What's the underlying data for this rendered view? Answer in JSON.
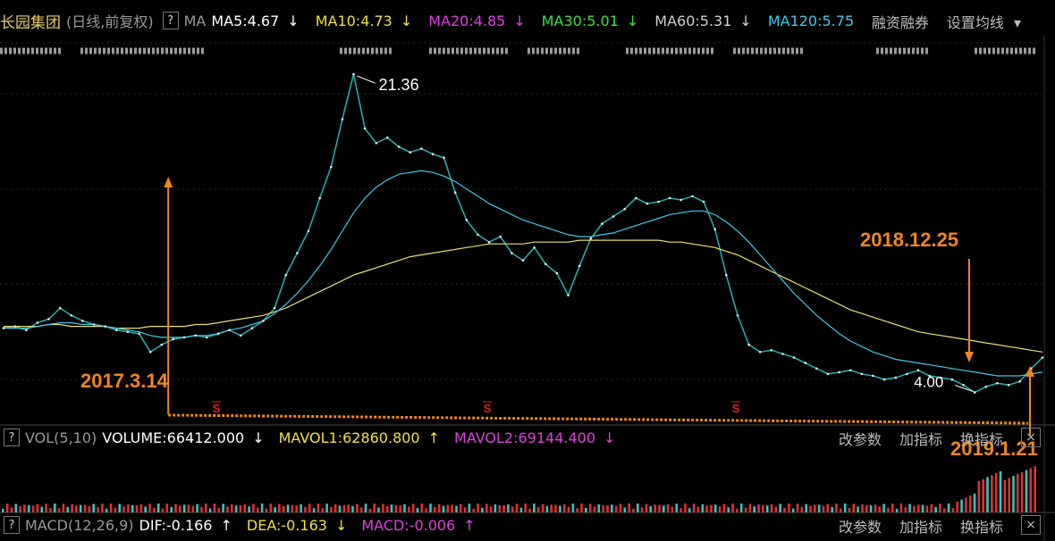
{
  "header": {
    "stock_name": "长园集团",
    "mode": "(日线,前复权)",
    "help": "?",
    "ma_label": "MA",
    "ma_items": [
      {
        "label": "MA5:4.67",
        "arrow": "↓",
        "color": "#ffffff"
      },
      {
        "label": "MA10:4.73",
        "arrow": "↓",
        "color": "#f0e040"
      },
      {
        "label": "MA20:4.85",
        "arrow": "↓",
        "color": "#e040e0"
      },
      {
        "label": "MA30:5.01",
        "arrow": "↓",
        "color": "#40e040"
      },
      {
        "label": "MA60:5.31",
        "arrow": "↓",
        "color": "#d0d0d0"
      },
      {
        "label": "MA120:5.75",
        "arrow": "",
        "color": "#40c8e8"
      }
    ],
    "margin_label": "融资融券",
    "settings_label": "设置均线",
    "settings_arrow": "▾"
  },
  "volume_panel": {
    "help": "?",
    "name": "VOL(5,10)",
    "items": [
      {
        "label": "VOLUME:66412.000",
        "arrow": "↓",
        "color": "#ffffff"
      },
      {
        "label": "MAVOL1:62860.800",
        "arrow": "↑",
        "color": "#f0e040"
      },
      {
        "label": "MAVOL2:69144.400",
        "arrow": "↓",
        "color": "#e040e0"
      }
    ],
    "buttons": [
      "改参数",
      "加指标",
      "换指标"
    ],
    "close": "×"
  },
  "macd_panel": {
    "help": "?",
    "name": "MACD(12,26,9)",
    "items": [
      {
        "label": "DIF:-0.166",
        "arrow": "↑",
        "color": "#ffffff"
      },
      {
        "label": "DEA:-0.163",
        "arrow": "↓",
        "color": "#f0e040"
      },
      {
        "label": "MACD:-0.006",
        "arrow": "↑",
        "color": "#e040e0"
      }
    ],
    "buttons": [
      "改参数",
      "加指标",
      "换指标"
    ],
    "close": "×"
  },
  "annotations": {
    "high_price": "21.36",
    "low_price": "4.00",
    "date_2017": "2017.3.14",
    "date_2018": "2018.12.25",
    "date_2019": "2019.1.21",
    "signal_marker": "S"
  },
  "colors": {
    "annotation_orange": "#f0861e",
    "price_line": "#2aa8a8",
    "ma_yellow": "#e8e070",
    "ma_cyan": "#40c8e8",
    "volume_red": "#e03030",
    "volume_cyan": "#40c0c0",
    "signal_red": "#e02020"
  },
  "chart_data": {
    "type": "line",
    "ylim": [
      3,
      22
    ],
    "series": [
      {
        "values": [
          7.5,
          7.6,
          7.4,
          7.8,
          8.0,
          8.6,
          8.2,
          7.9,
          7.7,
          7.6,
          7.4,
          7.3,
          7.2,
          6.2,
          6.6,
          6.9,
          7.0,
          7.1,
          7.0,
          7.2,
          7.4,
          7.1,
          7.5,
          7.9,
          8.6,
          10.4,
          11.6,
          12.8,
          14.6,
          16.3,
          18.9,
          21.36,
          18.4,
          17.6,
          17.9,
          17.4,
          17.1,
          17.3,
          17.0,
          16.8,
          14.9,
          13.4,
          12.6,
          12.2,
          12.5,
          11.6,
          11.2,
          11.9,
          11.0,
          10.5,
          9.3,
          10.9,
          12.4,
          13.2,
          13.6,
          14.0,
          14.6,
          14.3,
          14.4,
          14.6,
          14.5,
          14.7,
          14.4,
          12.9,
          10.4,
          8.2,
          6.6,
          6.2,
          6.3,
          6.1,
          5.9,
          5.6,
          5.3,
          5.0,
          5.1,
          5.2,
          5.0,
          4.9,
          4.7,
          4.8,
          5.0,
          5.2,
          4.9,
          4.8,
          4.7,
          4.4,
          4.0,
          4.3,
          4.5,
          4.4,
          4.6,
          5.3,
          5.9
        ]
      },
      {
        "values": [
          7.6,
          7.6,
          7.6,
          7.6,
          7.7,
          7.7,
          7.6,
          7.6,
          7.6,
          7.6,
          7.5,
          7.5,
          7.5,
          7.6,
          7.6,
          7.6,
          7.6,
          7.7,
          7.7,
          7.8,
          7.9,
          8.0,
          8.1,
          8.2,
          8.4,
          8.6,
          8.9,
          9.2,
          9.5,
          9.8,
          10.1,
          10.4,
          10.6,
          10.8,
          11.0,
          11.2,
          11.4,
          11.5,
          11.6,
          11.7,
          11.8,
          11.9,
          12.0,
          12.1,
          12.1,
          12.1,
          12.1,
          12.2,
          12.2,
          12.2,
          12.2,
          12.3,
          12.3,
          12.3,
          12.3,
          12.3,
          12.3,
          12.3,
          12.3,
          12.2,
          12.2,
          12.1,
          12.0,
          11.9,
          11.7,
          11.5,
          11.2,
          10.9,
          10.6,
          10.3,
          10.0,
          9.7,
          9.4,
          9.1,
          8.8,
          8.5,
          8.3,
          8.1,
          7.9,
          7.7,
          7.5,
          7.3,
          7.2,
          7.1,
          7.0,
          6.9,
          6.8,
          6.7,
          6.6,
          6.5,
          6.4,
          6.3,
          6.2
        ]
      },
      {
        "values": [
          7.5,
          7.5,
          7.5,
          7.6,
          7.7,
          7.8,
          7.8,
          7.7,
          7.7,
          7.6,
          7.5,
          7.4,
          7.3,
          7.1,
          7.0,
          7.0,
          7.0,
          7.1,
          7.1,
          7.2,
          7.4,
          7.5,
          7.7,
          7.9,
          8.3,
          8.8,
          9.4,
          10.1,
          10.9,
          11.8,
          12.8,
          13.8,
          14.6,
          15.2,
          15.6,
          15.9,
          16.0,
          16.1,
          16.0,
          15.8,
          15.5,
          15.1,
          14.7,
          14.3,
          14.0,
          13.7,
          13.4,
          13.2,
          13.0,
          12.8,
          12.6,
          12.5,
          12.5,
          12.6,
          12.7,
          12.9,
          13.1,
          13.3,
          13.5,
          13.7,
          13.8,
          13.9,
          13.9,
          13.7,
          13.3,
          12.8,
          12.2,
          11.5,
          10.8,
          10.1,
          9.4,
          8.8,
          8.2,
          7.7,
          7.2,
          6.8,
          6.5,
          6.2,
          6.0,
          5.8,
          5.7,
          5.6,
          5.5,
          5.4,
          5.3,
          5.2,
          5.1,
          5.0,
          4.9,
          4.9,
          4.9,
          5.0,
          5.1
        ]
      }
    ]
  }
}
